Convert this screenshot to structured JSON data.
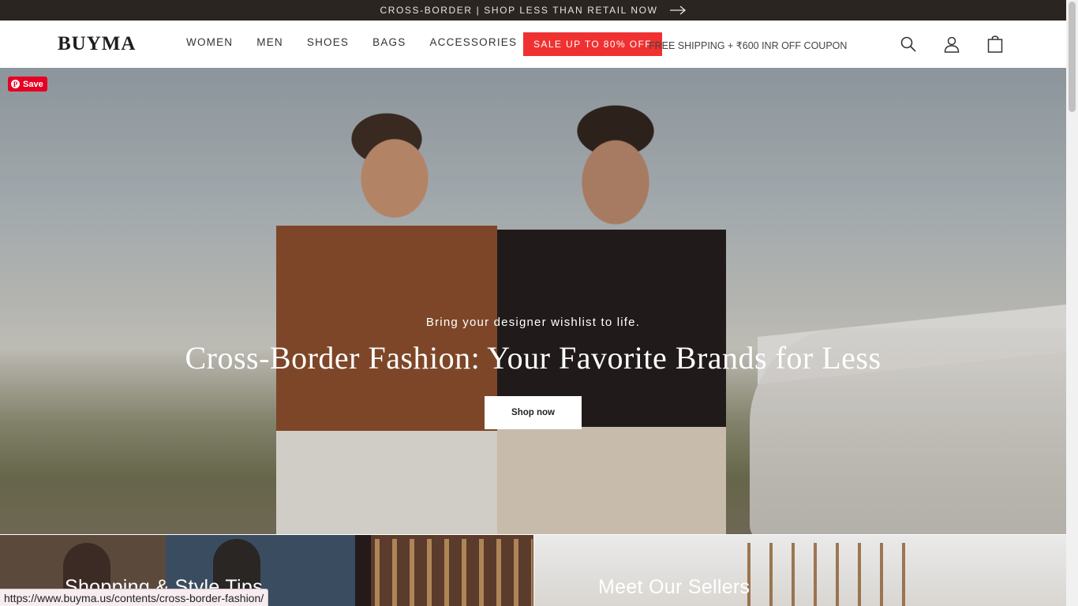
{
  "announcement": {
    "text": "CROSS-BORDER | SHOP LESS THAN RETAIL NOW",
    "icon": "arrow-right-icon"
  },
  "header": {
    "logo": "BUYMA",
    "nav": [
      "WOMEN",
      "MEN",
      "SHOES",
      "BAGS",
      "ACCESSORIES"
    ],
    "sale_label": "SALE UP TO 80% OFF",
    "promo": "FREE SHIPPING + ₹600 INR OFF COUPON",
    "icons": [
      "search-icon",
      "account-icon",
      "cart-icon"
    ]
  },
  "pinterest": {
    "label": "Save"
  },
  "hero": {
    "subtitle": "Bring your designer wishlist to life.",
    "title": "Cross-Border Fashion: Your Favorite Brands for Less",
    "cta": "Shop now"
  },
  "tiles": [
    {
      "title": "Shopping & Style Tips"
    },
    {
      "title": "Meet Our Sellers"
    }
  ],
  "status_url": "https://www.buyma.us/contents/cross-border-fashion/",
  "colors": {
    "announce_bg": "#2b2522",
    "sale_red": "#ef3131",
    "pinterest_red": "#e60023"
  }
}
